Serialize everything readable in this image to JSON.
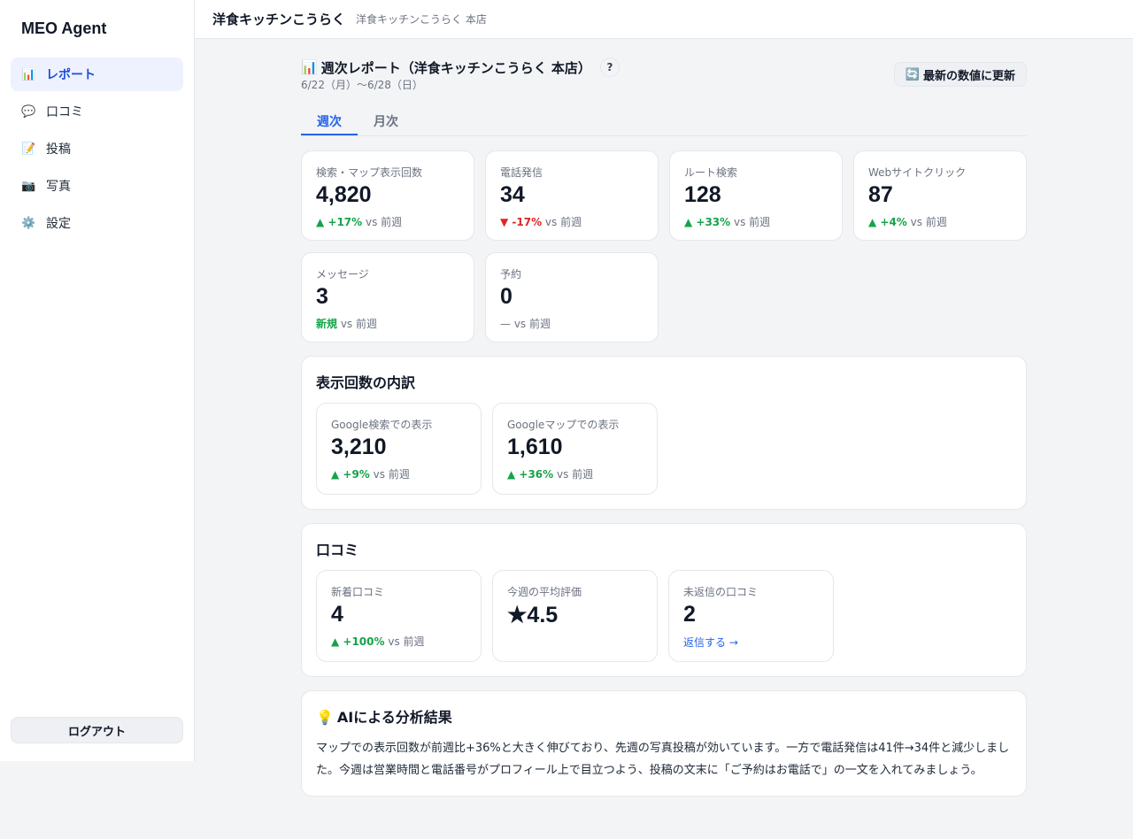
{
  "app": {
    "title": "MEO Agent"
  },
  "sidebar": {
    "items": [
      {
        "icon": "📊",
        "label": "レポート"
      },
      {
        "icon": "💬",
        "label": "口コミ"
      },
      {
        "icon": "📝",
        "label": "投稿"
      },
      {
        "icon": "📷",
        "label": "写真"
      },
      {
        "icon": "⚙️",
        "label": "設定"
      }
    ],
    "logout_label": "ログアウト"
  },
  "topbar": {
    "store_name": "洋食キッチンこうらく",
    "store_sub": "洋食キッチンこうらく 本店"
  },
  "report": {
    "icon": "📊",
    "title": "週次レポート（洋食キッチンこうらく 本店）",
    "help": "?",
    "date_range": "6/22（月）〜6/28（日）",
    "refresh_icon": "🔄",
    "refresh_label": "最新の数値に更新"
  },
  "tabs": [
    {
      "label": "週次"
    },
    {
      "label": "月次"
    }
  ],
  "metrics": [
    {
      "label": "検索・マップ表示回数",
      "value": "4,820",
      "delta": "▲ +17%",
      "vs": " vs 前週"
    },
    {
      "label": "電話発信",
      "value": "34",
      "delta": "▼ -17%",
      "vs": " vs 前週"
    },
    {
      "label": "ルート検索",
      "value": "128",
      "delta": "▲ +33%",
      "vs": " vs 前週"
    },
    {
      "label": "Webサイトクリック",
      "value": "87",
      "delta": "▲ +4%",
      "vs": " vs 前週"
    },
    {
      "label": "メッセージ",
      "value": "3",
      "delta": "新規",
      "vs": " vs 前週"
    },
    {
      "label": "予約",
      "value": "0",
      "delta": "—",
      "vs": " vs 前週"
    }
  ],
  "breakdown": {
    "title": "表示回数の内訳",
    "cards": [
      {
        "label": "Google検索での表示",
        "value": "3,210",
        "delta": "▲ +9%",
        "vs": " vs 前週"
      },
      {
        "label": "Googleマップでの表示",
        "value": "1,610",
        "delta": "▲ +36%",
        "vs": " vs 前週"
      }
    ]
  },
  "reviews": {
    "title": "口コミ",
    "new": {
      "label": "新着口コミ",
      "value": "4",
      "delta": "▲ +100%",
      "vs": " vs 前週"
    },
    "avg": {
      "label": "今週の平均評価",
      "value": "★4.5"
    },
    "unreplied": {
      "label": "未返信の口コミ",
      "value": "2",
      "link": "返信する →"
    }
  },
  "ai": {
    "icon": "💡",
    "title": "AIによる分析結果",
    "text": "マップでの表示回数が前週比+36%と大きく伸びており、先週の写真投稿が効いています。一方で電話発信は41件→34件と減少しました。今週は営業時間と電話番号がプロフィール上で目立つよう、投稿の文末に「ご予約はお電話で」の一文を入れてみましょう。"
  },
  "colors": {
    "accent": "#2563eb",
    "up": "#16a34a",
    "down": "#dc2626"
  }
}
